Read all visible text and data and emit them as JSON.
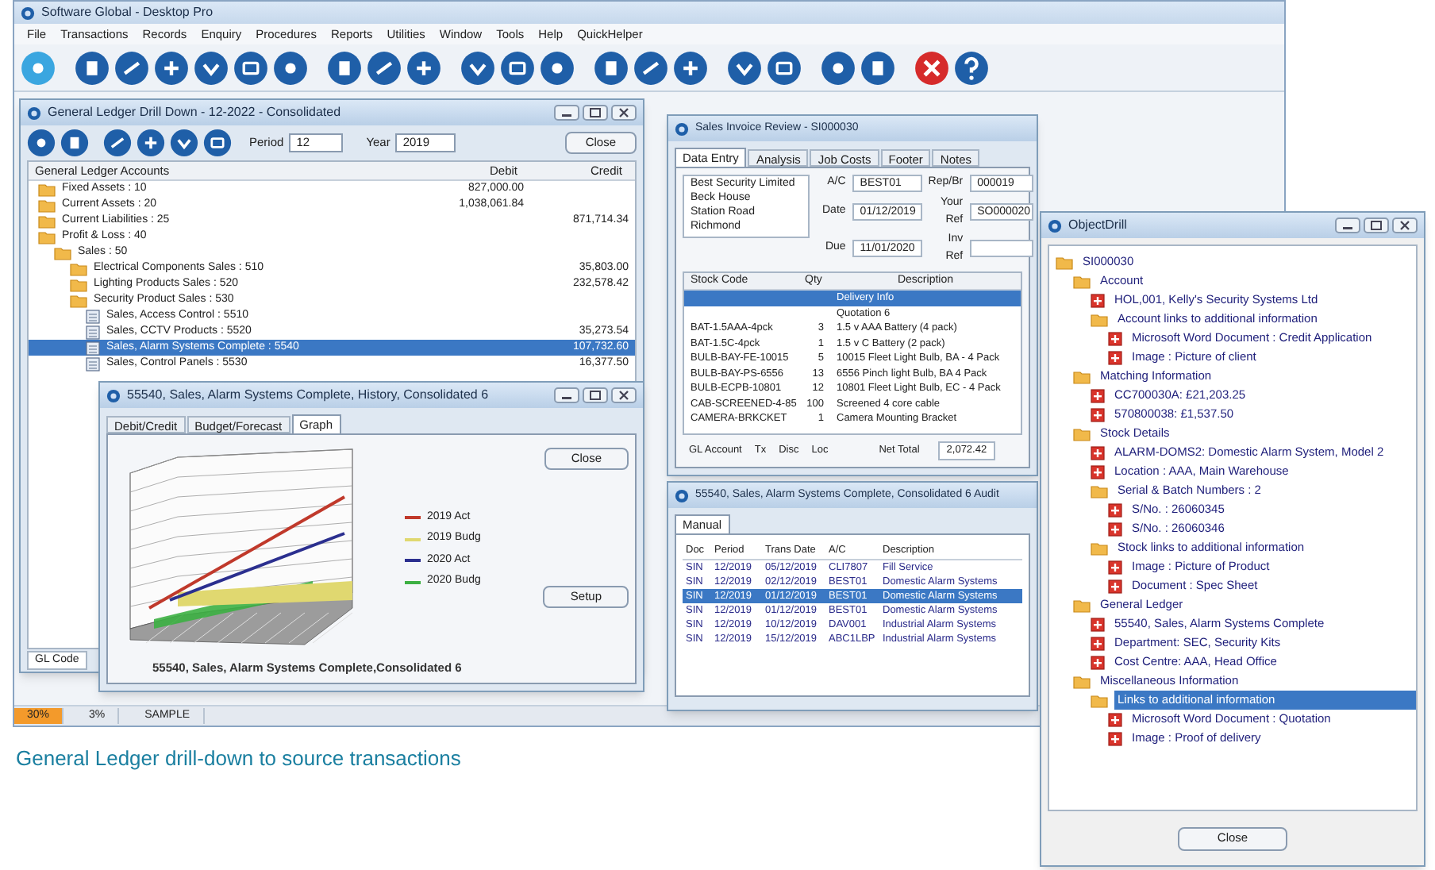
{
  "app": {
    "title": "Software Global - Desktop Pro",
    "menu": [
      "File",
      "Transactions",
      "Records",
      "Enquiry",
      "Procedures",
      "Reports",
      "Utilities",
      "Window",
      "Tools",
      "Help",
      "QuickHelper"
    ],
    "status": [
      "30%",
      "3%",
      "SAMPLE"
    ]
  },
  "gl_window": {
    "title": "General Ledger Drill Down - 12-2022 - Consolidated",
    "period_label": "Period",
    "period": "12",
    "year_label": "Year",
    "year": "2019",
    "close": "Close",
    "columns": [
      "General Ledger Accounts",
      "Debit",
      "Credit"
    ],
    "tree": [
      {
        "label": "Fixed Assets : 10",
        "kind": "folder",
        "selected": false,
        "debit": "827,000.00"
      },
      {
        "label": "Current Assets : 20",
        "kind": "folder",
        "selected": false,
        "debit": "1,038,061.84"
      },
      {
        "label": "Current Liabilities : 25",
        "kind": "folder",
        "selected": false,
        "credit": "871,714.34"
      },
      {
        "label": "Profit & Loss : 40",
        "kind": "folder",
        "selected": false,
        "children": [
          {
            "label": "Sales : 50",
            "kind": "folder",
            "selected": false,
            "children": [
              {
                "label": "Electrical Components Sales : 510",
                "kind": "folder",
                "selected": false,
                "credit": "35,803.00"
              },
              {
                "label": "Lighting Products Sales : 520",
                "kind": "folder",
                "selected": false,
                "credit": "232,578.42"
              },
              {
                "label": "Security Product Sales : 530",
                "kind": "folder",
                "selected": false,
                "children": [
                  {
                    "label": "Sales, Access Control : 5510",
                    "kind": "account",
                    "selected": false
                  },
                  {
                    "label": "Sales, CCTV Products : 5520",
                    "kind": "account",
                    "selected": false,
                    "credit": "35,273.54"
                  },
                  {
                    "label": "Sales, Alarm Systems Complete : 5540",
                    "kind": "account",
                    "selected": true,
                    "credit": "107,732.60"
                  },
                  {
                    "label": "Sales, Control Panels : 5530",
                    "kind": "account",
                    "selected": false,
                    "credit": "16,377.50"
                  }
                ]
              }
            ]
          }
        ]
      }
    ],
    "status": "GL Code"
  },
  "invoice_window": {
    "title": "Sales Invoice Review - SI000030",
    "tabs": [
      {
        "label": "Data Entry",
        "selected": true
      },
      {
        "label": "Analysis",
        "selected": false
      },
      {
        "label": "Job Costs",
        "selected": false
      },
      {
        "label": "Footer",
        "selected": false
      },
      {
        "label": "Notes",
        "selected": false
      }
    ],
    "address": [
      "Best Security Limited",
      "Beck House",
      "Station Road",
      "Richmond"
    ],
    "fields": [
      {
        "label": "A/C",
        "value": "BEST01"
      },
      {
        "label": "Date",
        "value": "01/12/2019"
      },
      {
        "label": "Due",
        "value": "11/01/2020"
      },
      {
        "label": "Rep/Br",
        "value": "000019"
      },
      {
        "label": "Your Ref",
        "value": "SO000020"
      },
      {
        "label": "Inv Ref"
      }
    ],
    "columns": [
      "Stock Code",
      "Qty",
      "Description"
    ],
    "rows": [
      {
        "code": "",
        "qty": "",
        "description": "Delivery Info",
        "selected": true
      },
      {
        "code": "",
        "qty": "",
        "description": "Quotation 6",
        "selected": false
      },
      {
        "code": "BAT-1.5AAA-4pck",
        "qty": "3",
        "description": "1.5 v AAA Battery (4 pack)",
        "selected": false
      },
      {
        "code": "BAT-1.5C-4pck",
        "qty": "1",
        "description": "1.5 v C Battery (2 pack)",
        "selected": false
      },
      {
        "code": "BULB-BAY-FE-10015",
        "qty": "5",
        "description": "10015 Fleet Light Bulb, BA - 4 Pack",
        "selected": false
      },
      {
        "code": "BULB-BAY-PS-6556",
        "qty": "13",
        "description": "6556 Pinch light Bulb, BA 4 Pack",
        "selected": false
      },
      {
        "code": "BULB-ECPB-10801",
        "qty": "12",
        "description": "10801 Fleet Light Bulb, EC - 4 Pack",
        "selected": false
      },
      {
        "code": "CAB-SCREENED-4-85",
        "qty": "100",
        "description": "Screened 4 core cable",
        "selected": false
      },
      {
        "code": "CAMERA-BRKCKET",
        "qty": "1",
        "description": "Camera Mounting Bracket",
        "selected": false
      }
    ],
    "footer_labels": [
      "GL Account",
      "Tx",
      "Disc",
      "Loc",
      "Net Total"
    ],
    "net_total": "2,072.42"
  },
  "graph_window": {
    "title": "55540, Sales, Alarm Systems Complete, History, Consolidated 6",
    "tabs": [
      {
        "label": "Debit/Credit",
        "selected": false
      },
      {
        "label": "Budget/Forecast",
        "selected": false
      },
      {
        "label": "Graph",
        "selected": true
      }
    ],
    "close": "Close",
    "setup": "Setup",
    "legend": [
      {
        "label": "2019 Act",
        "color": "#c0392b"
      },
      {
        "label": "2019 Budg",
        "color": "#e0d870"
      },
      {
        "label": "2020 Act",
        "color": "#2b2f8f"
      },
      {
        "label": "2020 Budg",
        "color": "#3cb043"
      }
    ],
    "caption": "55540, Sales, Alarm Systems Complete,Consolidated 6"
  },
  "audit_window": {
    "title": "55540, Sales, Alarm Systems Complete, Consolidated 6 Audit",
    "tabs": [
      {
        "label": "Manual",
        "selected": true
      }
    ],
    "columns": [
      "Doc",
      "Period",
      "Trans Date",
      "A/C",
      "Description"
    ],
    "rows": [
      {
        "cells": [
          "SIN",
          "12/2019",
          "05/12/2019",
          "CLI7807",
          "Fill Service"
        ],
        "selected": false
      },
      {
        "cells": [
          "SIN",
          "12/2019",
          "02/12/2019",
          "BEST01",
          "Domestic Alarm Systems"
        ],
        "selected": false
      },
      {
        "cells": [
          "SIN",
          "12/2019",
          "01/12/2019",
          "BEST01",
          "Domestic Alarm Systems"
        ],
        "selected": true
      },
      {
        "cells": [
          "SIN",
          "12/2019",
          "01/12/2019",
          "BEST01",
          "Domestic Alarm Systems"
        ],
        "selected": false
      },
      {
        "cells": [
          "SIN",
          "12/2019",
          "10/12/2019",
          "DAV001",
          "Industrial Alarm Systems"
        ],
        "selected": false
      },
      {
        "cells": [
          "SIN",
          "12/2019",
          "15/12/2019",
          "ABC1LBP",
          "Industrial Alarm Systems"
        ],
        "selected": false
      }
    ]
  },
  "object_drill": {
    "title": "ObjectDrill",
    "close": "Close",
    "tree": [
      {
        "label": "SI000030",
        "kind": "folder",
        "selected": false,
        "children": [
          {
            "label": "Account",
            "kind": "folder",
            "selected": false,
            "children": [
              {
                "label": "HOL,001, Kelly's Security Systems Ltd",
                "kind": "item",
                "selected": false
              },
              {
                "label": "Account links to additional information",
                "kind": "folder",
                "selected": false,
                "children": [
                  {
                    "label": "Microsoft Word Document : Credit Application",
                    "kind": "item",
                    "selected": false
                  },
                  {
                    "label": "Image : Picture of client",
                    "kind": "item",
                    "selected": false
                  }
                ]
              }
            ]
          },
          {
            "label": "Matching Information",
            "kind": "folder",
            "selected": false,
            "children": [
              {
                "label": "CC700030A: £21,203.25",
                "kind": "item",
                "selected": false
              },
              {
                "label": "570800038: £1,537.50",
                "kind": "item",
                "selected": false
              }
            ]
          },
          {
            "label": "Stock Details",
            "kind": "folder",
            "selected": false,
            "children": [
              {
                "label": "ALARM-DOMS2: Domestic Alarm System, Model 2",
                "kind": "item",
                "selected": false
              },
              {
                "label": "Location : AAA, Main Warehouse",
                "kind": "item",
                "selected": false
              },
              {
                "label": "Serial & Batch Numbers : 2",
                "kind": "folder",
                "selected": false,
                "children": [
                  {
                    "label": "S/No. : 26060345",
                    "kind": "item",
                    "selected": false
                  },
                  {
                    "label": "S/No. : 26060346",
                    "kind": "item",
                    "selected": false
                  }
                ]
              },
              {
                "label": "Stock links to additional information",
                "kind": "folder",
                "selected": false,
                "children": [
                  {
                    "label": "Image : Picture of Product",
                    "kind": "item",
                    "selected": false
                  },
                  {
                    "label": "Document : Spec Sheet",
                    "kind": "item",
                    "selected": false
                  }
                ]
              }
            ]
          },
          {
            "label": "General Ledger",
            "kind": "folder",
            "selected": false,
            "children": [
              {
                "label": "55540, Sales, Alarm Systems Complete",
                "kind": "item",
                "selected": false
              },
              {
                "label": "Department: SEC, Security Kits",
                "kind": "item",
                "selected": false
              },
              {
                "label": "Cost Centre: AAA, Head Office",
                "kind": "item",
                "selected": false
              }
            ]
          },
          {
            "label": "Miscellaneous Information",
            "kind": "folder",
            "selected": false,
            "children": [
              {
                "label": "Links to additional information",
                "kind": "folder",
                "selected": true,
                "children": [
                  {
                    "label": "Microsoft Word Document : Quotation",
                    "kind": "item",
                    "selected": false
                  },
                  {
                    "label": "Image : Proof of delivery",
                    "kind": "item",
                    "selected": false
                  }
                ]
              }
            ]
          }
        ]
      }
    ]
  },
  "caption": "General Ledger drill-down to source transactions"
}
